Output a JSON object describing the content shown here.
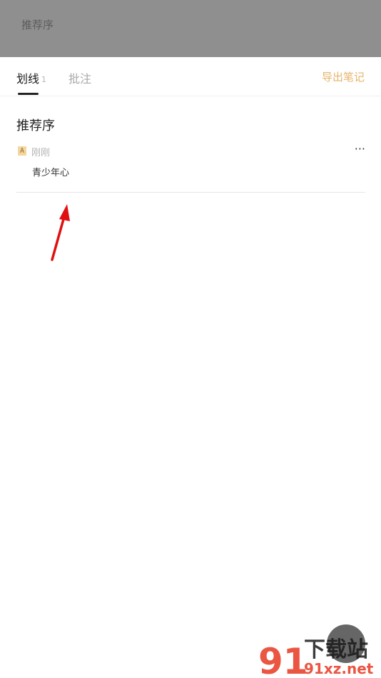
{
  "header": {
    "title": "推荐序"
  },
  "tabs": [
    {
      "label": "划线",
      "count": "1"
    },
    {
      "label": "批注"
    }
  ],
  "export_label": "导出笔记",
  "section": {
    "title": "推荐序"
  },
  "note": {
    "badge": "A",
    "time": "刚刚",
    "text": "青少年心",
    "more": "···"
  },
  "watermark": {
    "top": "下载站",
    "bottom": "91xz.net",
    "logo": "91"
  },
  "colors": {
    "accent": "#e6b46b",
    "arrow": "#e01010",
    "overlay": "#8f8f8f"
  }
}
